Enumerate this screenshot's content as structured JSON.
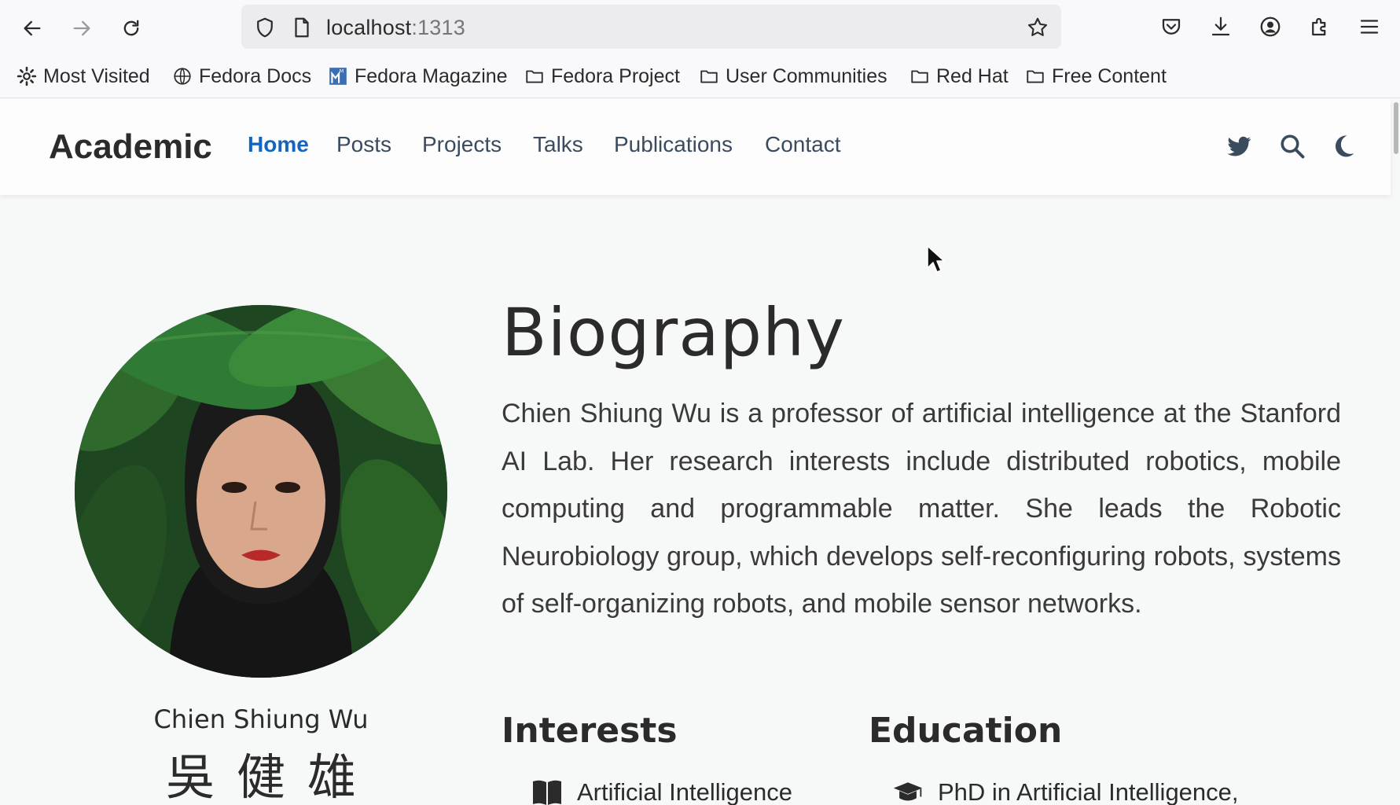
{
  "browser": {
    "url_host": "localhost",
    "url_port": ":1313",
    "icons": {
      "back": "arrow-left-icon",
      "forward": "arrow-right-icon",
      "reload": "reload-icon",
      "shield": "shield-icon",
      "page": "page-icon",
      "bookmark_star": "star-icon",
      "pocket": "pocket-icon",
      "downloads": "download-icon",
      "account": "account-icon",
      "extensions": "puzzle-icon",
      "menu": "hamburger-menu-icon"
    },
    "bookmarks": [
      {
        "label": "Most Visited",
        "icon": "gear-icon"
      },
      {
        "label": "Fedora Docs",
        "icon": "globe-icon"
      },
      {
        "label": "Fedora Magazine",
        "icon": "fedora-magazine-icon"
      },
      {
        "label": "Fedora Project",
        "icon": "folder-icon"
      },
      {
        "label": "User Communities",
        "icon": "folder-icon"
      },
      {
        "label": "Red Hat",
        "icon": "folder-icon"
      },
      {
        "label": "Free Content",
        "icon": "folder-icon"
      }
    ]
  },
  "site": {
    "brand": "Academic",
    "menu": [
      {
        "label": "Home",
        "active": true
      },
      {
        "label": "Posts",
        "active": false
      },
      {
        "label": "Projects",
        "active": false
      },
      {
        "label": "Talks",
        "active": false
      },
      {
        "label": "Publications",
        "active": false
      },
      {
        "label": "Contact",
        "active": false
      }
    ],
    "accent_color": "#1565c0",
    "nav_icons": [
      "twitter-icon",
      "search-icon",
      "moon-icon"
    ]
  },
  "profile": {
    "name": "Chien Shiung Wu",
    "name_cjk": "吳健雄"
  },
  "biography": {
    "title": "Biography",
    "text": "Chien Shiung Wu is a professor of artificial intelligence at the Stanford AI Lab. Her research interests include distributed robotics, mobile computing and programmable matter. She leads the Robotic Neurobiology group, which develops self-reconfiguring robots, systems of self-organizing robots, and mobile sensor networks."
  },
  "interests": {
    "title": "Interests",
    "items": [
      {
        "label": "Artificial Intelligence",
        "icon": "book-icon"
      }
    ]
  },
  "education": {
    "title": "Education",
    "items": [
      {
        "label": "PhD in Artificial Intelligence,",
        "icon": "graduation-cap-icon"
      }
    ]
  }
}
